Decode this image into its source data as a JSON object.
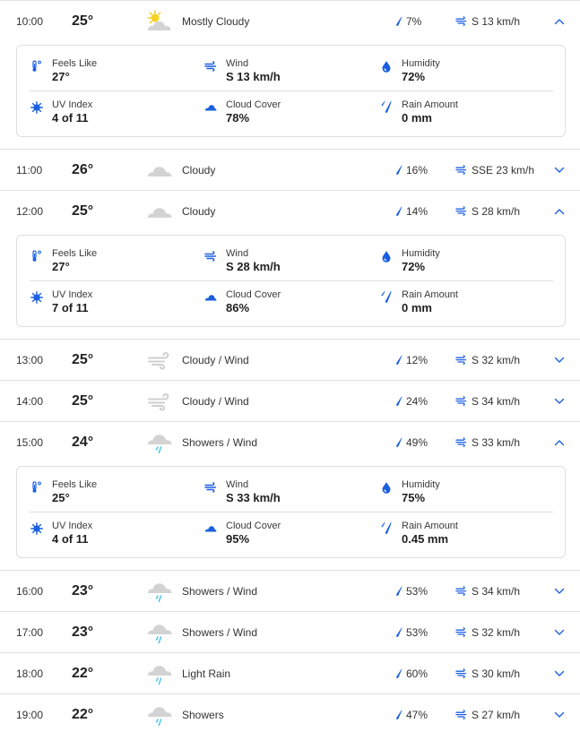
{
  "accent_color": "#1a5fe0",
  "labels": {
    "feels_like": "Feels Like",
    "wind": "Wind",
    "humidity": "Humidity",
    "uv_index": "UV Index",
    "cloud_cover": "Cloud Cover",
    "rain_amount": "Rain Amount"
  },
  "hours": [
    {
      "time": "10:00",
      "temp": "25°",
      "icon": "partly-sunny-icon",
      "condition": "Mostly Cloudy",
      "precip": "7%",
      "wind": "S 13 km/h",
      "expanded": true,
      "details": {
        "feels_like": "27°",
        "wind": "S 13 km/h",
        "humidity": "72%",
        "uv_index": "4 of 11",
        "cloud_cover": "78%",
        "rain_amount": "0 mm"
      }
    },
    {
      "time": "11:00",
      "temp": "26°",
      "icon": "cloud-icon",
      "condition": "Cloudy",
      "precip": "16%",
      "wind": "SSE 23 km/h",
      "expanded": false
    },
    {
      "time": "12:00",
      "temp": "25°",
      "icon": "cloud-icon",
      "condition": "Cloudy",
      "precip": "14%",
      "wind": "S 28 km/h",
      "expanded": true,
      "details": {
        "feels_like": "27°",
        "wind": "S 28 km/h",
        "humidity": "72%",
        "uv_index": "7 of 11",
        "cloud_cover": "86%",
        "rain_amount": "0 mm"
      }
    },
    {
      "time": "13:00",
      "temp": "25°",
      "icon": "wind-icon",
      "condition": "Cloudy / Wind",
      "precip": "12%",
      "wind": "S 32 km/h",
      "expanded": false
    },
    {
      "time": "14:00",
      "temp": "25°",
      "icon": "wind-icon",
      "condition": "Cloudy / Wind",
      "precip": "24%",
      "wind": "S 34 km/h",
      "expanded": false
    },
    {
      "time": "15:00",
      "temp": "24°",
      "icon": "rain-cloud-icon",
      "condition": "Showers / Wind",
      "precip": "49%",
      "wind": "S 33 km/h",
      "expanded": true,
      "details": {
        "feels_like": "25°",
        "wind": "S 33 km/h",
        "humidity": "75%",
        "uv_index": "4 of 11",
        "cloud_cover": "95%",
        "rain_amount": "0.45 mm"
      }
    },
    {
      "time": "16:00",
      "temp": "23°",
      "icon": "rain-cloud-icon",
      "condition": "Showers / Wind",
      "precip": "53%",
      "wind": "S 34 km/h",
      "expanded": false
    },
    {
      "time": "17:00",
      "temp": "23°",
      "icon": "rain-cloud-icon",
      "condition": "Showers / Wind",
      "precip": "53%",
      "wind": "S 32 km/h",
      "expanded": false
    },
    {
      "time": "18:00",
      "temp": "22°",
      "icon": "rain-cloud-icon",
      "condition": "Light Rain",
      "precip": "60%",
      "wind": "S 30 km/h",
      "expanded": false
    },
    {
      "time": "19:00",
      "temp": "22°",
      "icon": "rain-cloud-icon",
      "condition": "Showers",
      "precip": "47%",
      "wind": "S 27 km/h",
      "expanded": false
    }
  ]
}
